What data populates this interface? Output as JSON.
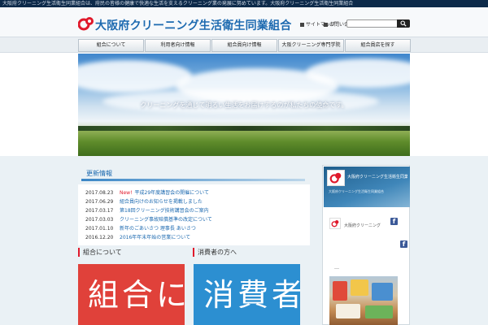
{
  "topbar": {
    "text": "大阪府クリーニング生活衛生同業組合は、府民の皆様の健康で快適な生活を支えるクリーニング業の発展に努めています。大阪府クリーニング生活衛生同業組合"
  },
  "header": {
    "title": "大阪府クリーニング生活衛生同業組合",
    "links": [
      "サイトマップ",
      "お問い合わせ"
    ],
    "search_placeholder": ""
  },
  "nav": {
    "items": [
      "組合について",
      "利用者向け情報",
      "組合員向け情報",
      "大阪クリーニング専門学院",
      "組合員店を探す"
    ]
  },
  "hero": {
    "tagline": "クリーニングを通じて明るい生活をお届けするのが私たちの使命です。"
  },
  "news": {
    "heading": "更新情報",
    "new_label": "New!",
    "items": [
      {
        "date": "2017.08.23",
        "text": "平成29年度講習会の開催について",
        "is_new": true
      },
      {
        "date": "2017.06.29",
        "text": "組合員向けのお知らせを掲載しました",
        "is_new": false
      },
      {
        "date": "2017.03.17",
        "text": "第18回クリーニング技術講習会のご案内",
        "is_new": false
      },
      {
        "date": "2017.03.03",
        "text": "クリーニング事故賠償基準の改定について",
        "is_new": false
      },
      {
        "date": "2017.01.10",
        "text": "新年のごあいさつ 理事長 あいさつ",
        "is_new": false
      },
      {
        "date": "2016.12.20",
        "text": "2016年年末年始の営業について",
        "is_new": false
      }
    ]
  },
  "boxes": [
    {
      "heading": "組合について",
      "big_text": "組合に",
      "color": "#e0413a"
    },
    {
      "heading": "消費者の方へ",
      "big_text": "消費者",
      "color": "#2c8fd1"
    }
  ],
  "facebook": {
    "page_name": "大阪府クリーニング生活衛生同業組合",
    "cover_sub": "大阪府クリーニング生活衛生同業組合",
    "post_author": "大阪府クリーニング",
    "icon": "f",
    "dots": "…"
  },
  "colors": {
    "brand_blue": "#1d6ab0",
    "accent_red": "#e0192b",
    "nav_bg": "#e9eef2"
  }
}
